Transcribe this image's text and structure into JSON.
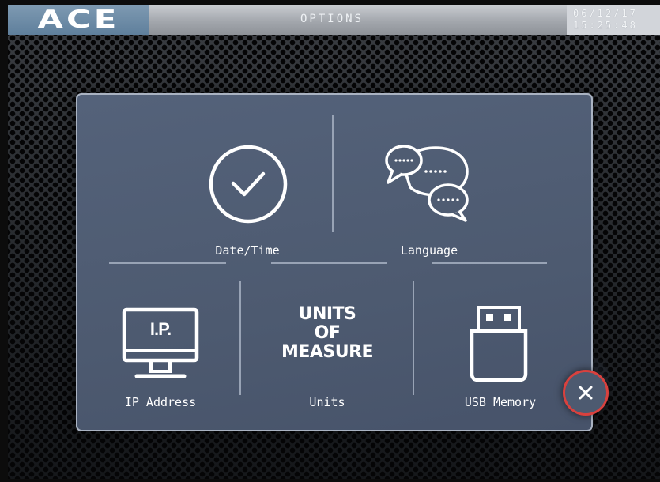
{
  "header": {
    "logo": "ACE",
    "title": "OPTIONS",
    "date": "06/12/17",
    "time": "15:25:48"
  },
  "options": {
    "date_time": {
      "label": "Date/Time",
      "icon": "clock-check-icon"
    },
    "language": {
      "label": "Language",
      "icon": "speech-bubbles-icon"
    },
    "ip_address": {
      "label": "IP Address",
      "icon": "monitor-ip-icon",
      "icon_text": "I.P."
    },
    "units": {
      "label": "Units",
      "icon_lines": [
        "UNITS",
        "OF",
        "MEASURE"
      ]
    },
    "usb_memory": {
      "label": "USB Memory",
      "icon": "usb-drive-icon"
    }
  },
  "close_button": {
    "icon": "close-icon",
    "ring_color": "#d9413e"
  },
  "colors": {
    "panel": "#4d5a70",
    "logo_bg": "#6a88a3"
  }
}
